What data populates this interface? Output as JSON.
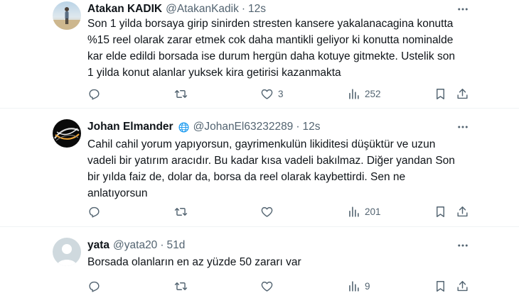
{
  "tweets": [
    {
      "name": "Atakan KADIK",
      "handle": "@AtakanKadik",
      "separator": "·",
      "time": "12s",
      "lines": [
        "Son 1 yilda borsaya girip sinirden stresten kansere yakalanacagina konutta",
        "%15 reel olarak zarar etmek cok daha mantikli geliyor ki konutta  nominalde",
        "kar elde edildi borsada ise durum hergün daha kotuye gitmekte. Ustelik son",
        "1 yilda konut alanlar yuksek kira getirisi kazanmakta"
      ],
      "likes": "3",
      "views": "252"
    },
    {
      "name": "Johan Elmander",
      "handle": "@JohanEl63232289",
      "separator": "·",
      "time": "12s",
      "lines": [
        "Cahil cahil yorum yapıyorsun, gayrimenkulün likiditesi düşüktür ve uzun",
        "vadeli bir yatırım aracıdır.  Bu kadar kısa vadeli bakılmaz. Diğer yandan Son",
        "bir yılda faiz de, dolar da, borsa da reel olarak kaybettirdi. Sen ne",
        "anlatıyorsun"
      ],
      "likes": "",
      "views": "201"
    },
    {
      "name": "yata",
      "handle": "@yata20",
      "separator": "·",
      "time": "51d",
      "lines": [
        "Borsada olanların en az yüzde 50 zararı var"
      ],
      "likes": "",
      "views": "9"
    }
  ],
  "icons": {
    "reply": "reply-icon",
    "retweet": "retweet-icon",
    "like": "heart-icon",
    "views": "views-icon",
    "bookmark": "bookmark-icon",
    "share": "share-icon",
    "more": "more-icon",
    "globe": "globe-icon"
  },
  "colors": {
    "text": "#0f1419",
    "secondary": "#536471",
    "divider": "#eff3f4",
    "globe": "#1d9bf0"
  }
}
